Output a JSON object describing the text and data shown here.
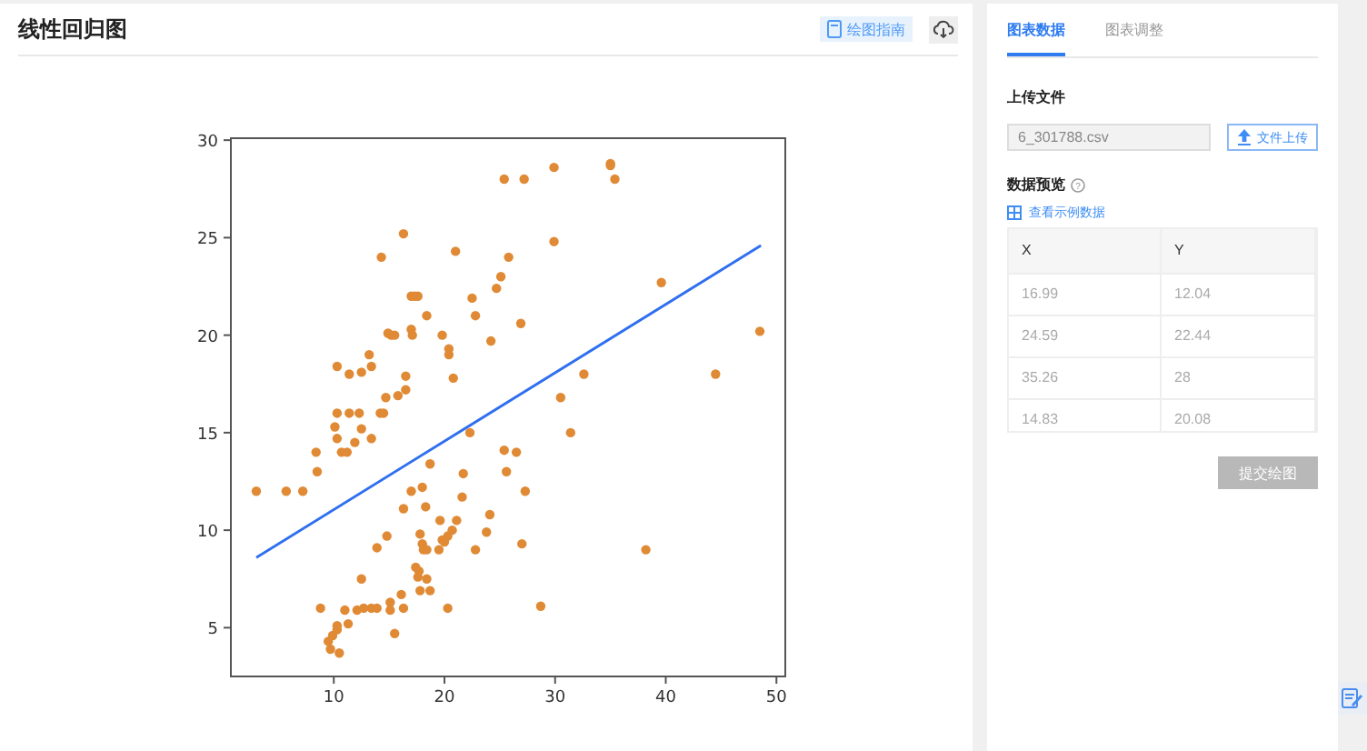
{
  "chart_panel": {
    "title": "线性回归图",
    "guide_button": "绘图指南",
    "chart_data": {
      "type": "scatter",
      "xlim": [
        0.7,
        50.8
      ],
      "ylim": [
        2.5,
        30.1
      ],
      "xticks": [
        10,
        20,
        30,
        40,
        50
      ],
      "yticks": [
        5,
        10,
        15,
        20,
        25,
        30
      ],
      "series": [
        {
          "color": "#e08a35",
          "x": [
            3,
            5.7,
            7.2,
            8.4,
            8.5,
            8.8,
            9.5,
            9.7,
            9.9,
            10.3,
            10.3,
            10.5,
            10.1,
            10.3,
            10.3,
            10.3,
            10.7,
            11.2,
            11,
            11.3,
            11.4,
            11.4,
            11.9,
            12.1,
            12.3,
            12.5,
            12.5,
            12.5,
            12.7,
            13.2,
            13.4,
            13.4,
            13.4,
            13.9,
            13.9,
            14.2,
            14.3,
            14.5,
            14.7,
            14.8,
            14.9,
            15.1,
            15.1,
            15.2,
            15.5,
            15.5,
            15.8,
            16.1,
            16.3,
            16.3,
            16.3,
            16.5,
            16.5,
            17,
            17,
            17,
            17.1,
            17.3,
            17.4,
            17.6,
            17.6,
            17.7,
            17.8,
            17.8,
            18,
            18,
            18.1,
            18.3,
            18.4,
            18.4,
            18.4,
            18.7,
            18.7,
            19.5,
            19.6,
            19.8,
            19.8,
            20,
            20.3,
            20.3,
            20.4,
            20.4,
            20.7,
            20.8,
            21,
            21.1,
            21.6,
            21.7,
            22.3,
            22.5,
            22.8,
            22.8,
            23.8,
            24.1,
            24.2,
            24.7,
            25.1,
            25.4,
            25.4,
            25.6,
            25.8,
            26.5,
            26.9,
            27,
            27.2,
            27.3,
            28.7,
            29.9,
            29.9,
            30.5,
            31.4,
            32.6,
            35,
            35,
            35.4,
            38.2,
            39.6,
            44.5,
            48.5
          ],
          "values": [
            12,
            12,
            12,
            14,
            13,
            6,
            4.3,
            3.9,
            4.6,
            5.1,
            4.9,
            3.7,
            15.3,
            14.7,
            16,
            18.4,
            14,
            14,
            5.9,
            5.2,
            18,
            16,
            14.5,
            5.9,
            16,
            15.2,
            7.5,
            18.1,
            6,
            19,
            18.4,
            14.7,
            6,
            6,
            9.1,
            16,
            24,
            16,
            16.8,
            9.7,
            20.1,
            6.3,
            5.9,
            20,
            20,
            4.7,
            16.9,
            6.7,
            11.1,
            25.2,
            6,
            17.2,
            17.9,
            12,
            22,
            20.3,
            20,
            22,
            8.1,
            7.6,
            22,
            7.9,
            9.8,
            6.9,
            12.2,
            9.3,
            9,
            11.2,
            21,
            9,
            7.5,
            6.9,
            13.4,
            9,
            10.5,
            20,
            9.5,
            9.4,
            9.7,
            6,
            19.3,
            19,
            10,
            17.8,
            24.3,
            10.5,
            11.7,
            12.9,
            15,
            21.9,
            21,
            9,
            9.9,
            10.8,
            19.7,
            22.4,
            23,
            28,
            14.1,
            13,
            24,
            14,
            20.6,
            9.3,
            28,
            12,
            6.1,
            28.6,
            24.8,
            16.8,
            15,
            18,
            28.8,
            28.7,
            28,
            9,
            22.7,
            18,
            20.2
          ]
        },
        {
          "type": "line",
          "color": "#2f6fef",
          "x": [
            3,
            48.6
          ],
          "values": [
            8.6,
            24.6
          ]
        }
      ]
    }
  },
  "side_panel": {
    "tabs": [
      {
        "label": "图表数据",
        "selected": true
      },
      {
        "label": "图表调整",
        "selected": false
      }
    ],
    "upload_heading": "上传文件",
    "file_field": {
      "value": "6_301788.csv"
    },
    "upload_button": "文件上传",
    "preview_heading": "数据预览",
    "help_mark": "?",
    "sample_link": "查看示例数据",
    "table": {
      "columns": [
        "X",
        "Y"
      ],
      "rows": [
        [
          "16.99",
          "12.04"
        ],
        [
          "24.59",
          "22.44"
        ],
        [
          "35.26",
          "28"
        ],
        [
          "14.83",
          "20.08"
        ]
      ]
    },
    "submit_button": {
      "label": "提交绘图",
      "disabled": true
    }
  }
}
